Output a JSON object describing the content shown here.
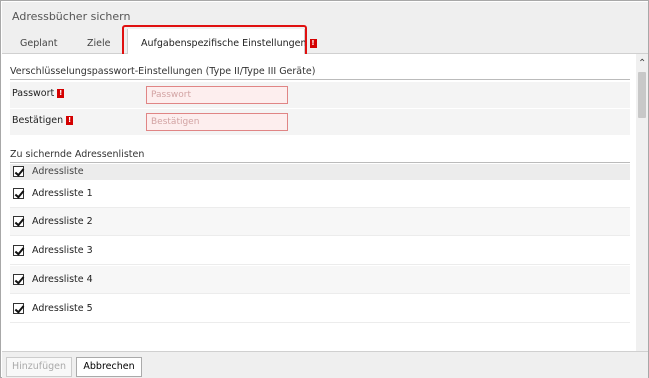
{
  "dialog": {
    "title": "Adressbücher sichern"
  },
  "tabs": [
    {
      "label": "Geplant"
    },
    {
      "label": "Ziele"
    },
    {
      "label": "Aufgabenspezifische Einstellungen",
      "badge": "!"
    }
  ],
  "encryption": {
    "heading": "Verschlüsselungspasswort-Einstellungen (Type II/Type III Geräte)",
    "password": {
      "label": "Passwort",
      "badge": "!",
      "value": "",
      "placeholder": "Passwort"
    },
    "confirm": {
      "label": "Bestätigen",
      "badge": "!",
      "value": "",
      "placeholder": "Bestätigen"
    }
  },
  "addresslists": {
    "heading": "Zu sichernde Adressenlisten",
    "column_header": "Adressliste",
    "items": [
      {
        "label": "Adressliste 1",
        "checked": true
      },
      {
        "label": "Adressliste 2",
        "checked": true
      },
      {
        "label": "Adressliste 3",
        "checked": true
      },
      {
        "label": "Adressliste 4",
        "checked": true
      },
      {
        "label": "Adressliste 5",
        "checked": true
      }
    ]
  },
  "footer": {
    "add_label": "Hinzufügen",
    "cancel_label": "Abbrechen"
  },
  "colors": {
    "required_badge": "#d40000",
    "highlight_border": "#e01010",
    "invalid_field_bg": "#fdeeee"
  }
}
